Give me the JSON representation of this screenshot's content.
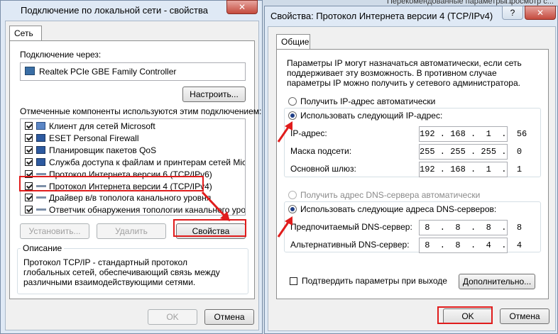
{
  "bg_titles": {
    "t1": "Перекомендованные параметры...",
    "t2": "Просмотр с..."
  },
  "left": {
    "title": "Подключение по локальной сети - свойства",
    "close_glyph": "✕",
    "tab": "Сеть",
    "connect_via_label": "Подключение через:",
    "adapter": "Realtek PCIe GBE Family Controller",
    "configure_btn": "Настроить...",
    "components_label": "Отмеченные компоненты используются этим подключением:",
    "components": [
      {
        "label": "Клиент для сетей Microsoft",
        "checked": true,
        "icon": "network-client-icon"
      },
      {
        "label": "ESET Personal Firewall",
        "checked": true,
        "icon": "computer-icon"
      },
      {
        "label": "Планировщик пакетов QoS",
        "checked": true,
        "icon": "computer-icon"
      },
      {
        "label": "Служба доступа к файлам и принтерам сетей Micro...",
        "checked": true,
        "icon": "computer-icon"
      },
      {
        "label": "Протокол Интернета версии 6 (TCP/IPv6)",
        "checked": true,
        "icon": "protocol-icon"
      },
      {
        "label": "Протокол Интернета версии 4 (TCP/IPv4)",
        "checked": true,
        "icon": "protocol-icon"
      },
      {
        "label": "Драйвер в/в тополога канального уровня",
        "checked": true,
        "icon": "protocol-icon"
      },
      {
        "label": "Ответчик обнаружения топологии канального уровня",
        "checked": true,
        "icon": "protocol-icon"
      }
    ],
    "install_btn": "Установить...",
    "remove_btn": "Удалить",
    "properties_btn": "Свойства",
    "description_title": "Описание",
    "description_text": "Протокол TCP/IP - стандартный протокол глобальных сетей, обеспечивающий связь между различными взаимодействующими сетями.",
    "ok_btn": "OK",
    "cancel_btn": "Отмена"
  },
  "right": {
    "title": "Свойства: Протокол Интернета версии 4 (TCP/IPv4)",
    "help_glyph": "?",
    "close_glyph": "✕",
    "tab": "Общие",
    "intro_text": "Параметры IP могут назначаться автоматически, если сеть поддерживает эту возможность. В противном случае параметры IP можно получить у сетевого администратора.",
    "auto_ip": "Получить IP-адрес автоматически",
    "manual_ip": "Использовать следующий IP-адрес:",
    "ip_label": "IP-адрес:",
    "ip_value": "192 . 168 .  1  .  56",
    "mask_label": "Маска подсети:",
    "mask_value": "255 . 255 . 255 .  0",
    "gateway_label": "Основной шлюз:",
    "gateway_value": "192 . 168 .  1  .  1",
    "auto_dns": "Получить адрес DNS-сервера автоматически",
    "manual_dns": "Использовать следующие адреса DNS-серверов:",
    "preferred_dns_label": "Предпочитаемый DNS-сервер:",
    "preferred_dns_value": " 8  .  8  .  8  .  8",
    "alternate_dns_label": "Альтернативный DNS-сервер:",
    "alternate_dns_value": " 8  .  8  .  4  .  4",
    "validate_label": "Подтвердить параметры при выходе",
    "advanced_btn": "Дополнительно...",
    "ok_btn": "OK",
    "cancel_btn": "Отмена"
  },
  "accent": {
    "highlight": "#e01c1c",
    "radio_dot": "#1f3f86"
  }
}
